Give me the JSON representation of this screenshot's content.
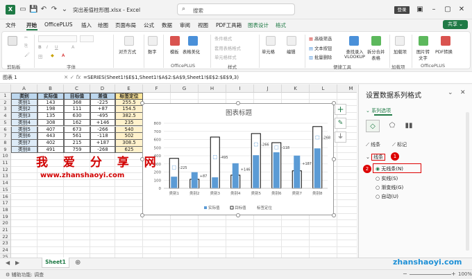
{
  "titlebar": {
    "file_title": "突出差值柱形图.xlsx - Excel",
    "search_placeholder": "搜索",
    "login": "登录",
    "autosave_label": "自动保存"
  },
  "menu": {
    "items": [
      "文件",
      "开始",
      "OfficePLUS",
      "插入",
      "绘图",
      "页面布局",
      "公式",
      "数据",
      "审阅",
      "视图",
      "PDF工具箱",
      "图表设计",
      "格式"
    ],
    "active": "开始",
    "share": "共享"
  },
  "ribbon": {
    "groups": [
      "剪贴板",
      "字体",
      "对齐方式",
      "数字",
      "OfficePLUS",
      "样式",
      "单元格",
      "编辑",
      "便捷工具",
      "加载项",
      "OfficePLUS"
    ],
    "buttons": {
      "align": "对齐方式",
      "number": "数字",
      "template": "模板",
      "beautify": "表格美化",
      "cond_format": "条件格式",
      "table_format": "套用表格格式",
      "cell_style": "单元格样式",
      "cells": "单元格",
      "edit": "编辑",
      "adv_filter": "高级筛选",
      "text_convert": "文本按钮",
      "batch_delete": "批量删除",
      "vlookup": "查找录入\nVLOOKUP",
      "split_merge": "拆分合并\n表格",
      "addins": "加载项",
      "img_to_text": "图片转\n文字",
      "pdf_convert": "PDF转换"
    }
  },
  "formulabar": {
    "namebox": "图表 1",
    "formula": "=SERIES(Sheet1!$E$1,Sheet1!$A$2:$A$9,Sheet1!$E$2:$E$9,3)"
  },
  "sheet": {
    "columns": [
      "A",
      "B",
      "C",
      "D",
      "E",
      "F",
      "G",
      "H",
      "I",
      "J",
      "K",
      "L",
      "M"
    ],
    "rows": [
      "1",
      "2",
      "3",
      "4",
      "5",
      "6",
      "7",
      "8",
      "9",
      "10",
      "11",
      "12",
      "13",
      "14",
      "15",
      "16",
      "17",
      "18",
      "19",
      "20",
      "21",
      "22",
      "23",
      "24",
      "25"
    ],
    "headers": [
      "类别",
      "实际值",
      "目标值",
      "差值",
      "标签定位"
    ],
    "data": [
      [
        "类别1",
        "143",
        "368",
        "-225",
        "255.5"
      ],
      [
        "类别2",
        "198",
        "111",
        "+87",
        "154.5"
      ],
      [
        "类别3",
        "135",
        "630",
        "-495",
        "382.5"
      ],
      [
        "类别4",
        "308",
        "162",
        "+146",
        "235"
      ],
      [
        "类别5",
        "407",
        "673",
        "-266",
        "540"
      ],
      [
        "类别6",
        "443",
        "561",
        "-118",
        "502"
      ],
      [
        "类别7",
        "402",
        "215",
        "+187",
        "308.5"
      ],
      [
        "类别8",
        "491",
        "759",
        "-268",
        "625"
      ]
    ],
    "tab": "Sheet1",
    "status": "辅助功能: 调查"
  },
  "watermarks": {
    "cn": "我 爱 分 享 网",
    "url": "www.zhanshaoyi.com",
    "url2": "zhanshaoyi.com"
  },
  "chart_data": {
    "type": "bar",
    "title": "图表标题",
    "categories": [
      "类别1",
      "类别2",
      "类别3",
      "类别4",
      "类别5",
      "类别6",
      "类别7",
      "类别8"
    ],
    "series": [
      {
        "name": "实际值",
        "values": [
          143,
          198,
          135,
          308,
          407,
          443,
          402,
          491
        ]
      },
      {
        "name": "目标值",
        "values": [
          368,
          111,
          630,
          162,
          673,
          561,
          215,
          759
        ]
      },
      {
        "name": "标签定位",
        "values": [
          255.5,
          154.5,
          382.5,
          235,
          540,
          502,
          308.5,
          625
        ]
      }
    ],
    "diff_labels": [
      "-225",
      "+87",
      "-495",
      "+146",
      "-266",
      "-118",
      "+187",
      "-268"
    ],
    "ylim": [
      0,
      800
    ],
    "yticks": [
      "0",
      "100",
      "200",
      "300",
      "400",
      "500",
      "600",
      "700",
      "800"
    ],
    "legend": "bottom",
    "colors": {
      "actual": "#5b9bd5",
      "target_border": "#000000",
      "label": "#5b9bd5"
    }
  },
  "pane": {
    "title": "设置数据系列格式",
    "section": "系列选项",
    "tabs": [
      "线条",
      "标记"
    ],
    "line_header": "线条",
    "options": [
      "无线条(N)",
      "实线(S)",
      "渐变线(G)",
      "自动(U)"
    ],
    "selected": "无线条(N)",
    "badge1": "1",
    "badge2": "2"
  },
  "statusbar": {
    "zoom": "100%"
  }
}
